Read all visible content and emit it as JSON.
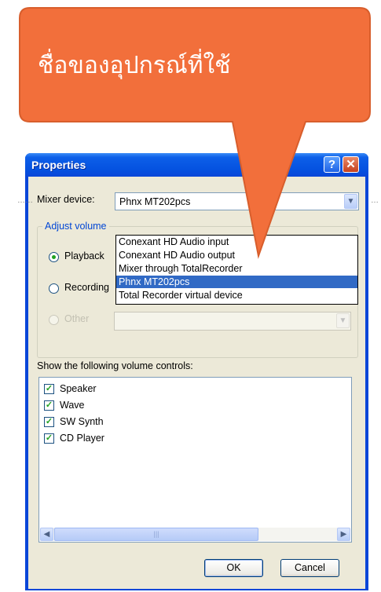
{
  "dialog": {
    "title": "Properties",
    "help_label": "?",
    "close_label": "✕"
  },
  "mixer": {
    "label": "Mixer device:",
    "selected": "Phnx MT202pcs",
    "options": [
      "Conexant HD Audio input",
      "Conexant HD Audio output",
      "Mixer through TotalRecorder",
      "Phnx MT202pcs",
      "Total Recorder virtual device"
    ]
  },
  "adjust": {
    "group_title": "Adjust volume",
    "playback_label": "Playback",
    "recording_label": "Recording",
    "other_label": "Other",
    "selected": "Playback"
  },
  "controls": {
    "label": "Show the following volume controls:",
    "items": [
      {
        "label": "Speaker",
        "checked": true
      },
      {
        "label": "Wave",
        "checked": true
      },
      {
        "label": "SW Synth",
        "checked": true
      },
      {
        "label": "CD Player",
        "checked": true
      }
    ]
  },
  "buttons": {
    "ok": "OK",
    "cancel": "Cancel"
  },
  "callout": {
    "text": "ชื่อของอุปกรณ์ที่ใช้",
    "fill": "#f26f3b",
    "stroke": "#d85e2c"
  },
  "icons": {
    "dropdown_arrow": "chevron-down-icon",
    "scroll_left": "arrow-left-icon",
    "scroll_right": "arrow-right-icon",
    "check": "check-icon"
  }
}
